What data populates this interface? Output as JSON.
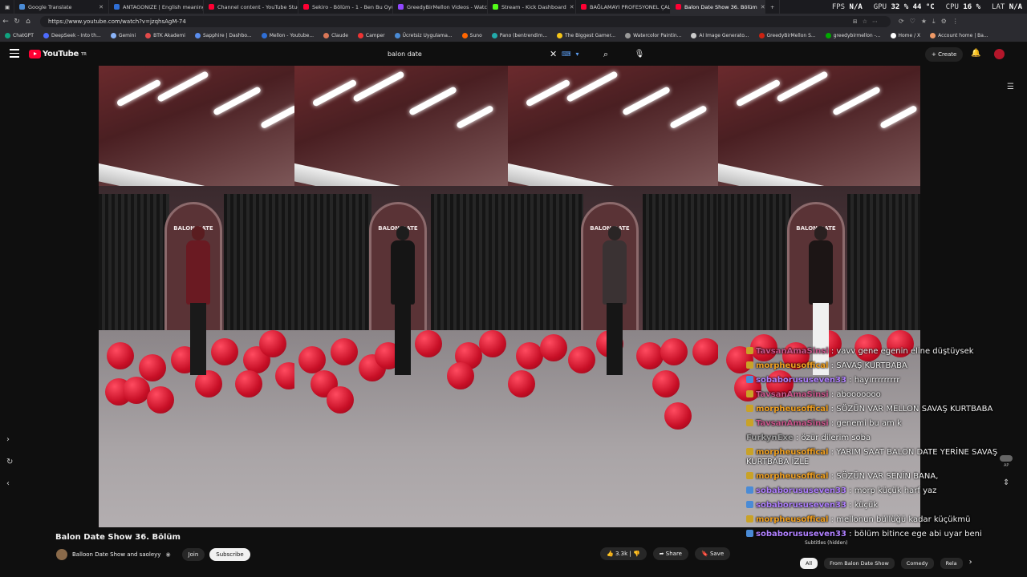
{
  "browser": {
    "tabs": [
      {
        "title": "Google Translate",
        "color": "#4a8bd6"
      },
      {
        "title": "ANTAGONIZE | English meaning -",
        "color": "#2f6fd6"
      },
      {
        "title": "Channel content - YouTube Studio",
        "color": "#ff0033"
      },
      {
        "title": "Sekiro - Bölüm - 1 - Ben Bu Oyunu",
        "color": "#ff0033"
      },
      {
        "title": "GreedyBirMellon Videos - Watch",
        "color": "#9147ff"
      },
      {
        "title": "Stream - Kick Dashboard",
        "color": "#53fc18"
      },
      {
        "title": "BAĞLAMAYI PROFESYONEL ÇALM",
        "color": "#ff0033"
      },
      {
        "title": "Balon Date Show 36. Bölüm",
        "color": "#ff0033"
      }
    ],
    "stats": {
      "fps_label": "FPS",
      "fps": "N/A",
      "gpu_label": "GPU",
      "gpu": "32 % 44 °C",
      "cpu_label": "CPU",
      "cpu": "16 %",
      "lat_label": "LAT",
      "lat": "N/A"
    },
    "url": "https://www.youtube.com/watch?v=jzqhsAgM-74",
    "bookmarks": [
      "ChatGPT",
      "DeepSeek - Into th...",
      "Gemini",
      "BTK Akademi",
      "Sapphire | Dashbo...",
      "Mellon - Youtube...",
      "Claude",
      "Camper",
      "Ücretsiz Uygulama...",
      "Suno",
      "Pano (bentrendim...",
      "The Biggest Gamer...",
      "Watercolor Paintin...",
      "AI Image Generato...",
      "GreedyBirMellon S...",
      "greedybirmellon -...",
      "Home / X",
      "Account home | Ba..."
    ]
  },
  "youtube": {
    "logo": "YouTube",
    "region": "TR",
    "search_value": "balon date",
    "create_label": "Create"
  },
  "player": {
    "panels": [
      {
        "sign": "BALON DATE",
        "top_color": "#5a1d20",
        "body_color": "#6a1a22",
        "legs_color": "#1a1a1a"
      },
      {
        "sign": "BALON DATE",
        "top_color": "#1d1d1d",
        "body_color": "#151515",
        "legs_color": "#151515"
      },
      {
        "sign": "BALON DATE",
        "top_color": "#2a2525",
        "body_color": "#3a3233",
        "legs_color": "#161616"
      },
      {
        "sign": "BALON DATE",
        "top_color": "#2a2020",
        "body_color": "#1c1515",
        "legs_color": "#f0f0f0"
      }
    ]
  },
  "chat": [
    {
      "user": "TavsanAmaSinsi",
      "color": "#c8558a",
      "badge": "gold",
      "text": "vavv gene egenin eline düştüysek"
    },
    {
      "user": "morpheusoffical",
      "color": "#f0a020",
      "badge": "gold",
      "text": "SAVAŞ KURTBABA"
    },
    {
      "user": "sobaborususeven33",
      "color": "#b080ff",
      "badge": "blue",
      "text": "hayırrrrrrrrr"
    },
    {
      "user": "TavsanAmaSinsi",
      "color": "#c8558a",
      "badge": "gold",
      "text": "abooooooo"
    },
    {
      "user": "morpheusoffical",
      "color": "#f0a020",
      "badge": "gold",
      "text": "SÖZÜN VAR MELLON SAVAŞ KURTBABA"
    },
    {
      "user": "TavsanAmaSinsi",
      "color": "#c8558a",
      "badge": "gold",
      "text": "genemi bu am k"
    },
    {
      "user": "FurkynExe",
      "color": "#a0a0a0",
      "badge": "",
      "text": "özür dilerim soba"
    },
    {
      "user": "morpheusoffical",
      "color": "#f0a020",
      "badge": "gold",
      "text": "YARIM SAAT BALON DATE YERİNE SAVAŞ KURTBABA İZLE"
    },
    {
      "user": "morpheusoffical",
      "color": "#f0a020",
      "badge": "gold",
      "text": "SÖZÜN VAR SENİN BANA,"
    },
    {
      "user": "sobaborususeven33",
      "color": "#b080ff",
      "badge": "blue",
      "text": "morp küçük harf yaz"
    },
    {
      "user": "sobaborususeven33",
      "color": "#b080ff",
      "badge": "blue",
      "text": "küçük"
    },
    {
      "user": "morpheusoffical",
      "color": "#f0a020",
      "badge": "gold",
      "text": "mellonun büllüğü kadar küçükmü"
    },
    {
      "user": "sobaborususeven33",
      "color": "#b080ff",
      "badge": "blue",
      "text": "bölüm bitince ege abi uyar beni"
    }
  ],
  "video": {
    "title": "Balon Date Show 36. Bölüm",
    "channel": "Balloon Date Show and saoleyy",
    "join_label": "Join",
    "subscribe_label": "Subscribe",
    "likes": "3.3k",
    "share_label": "Share",
    "save_label": "Save",
    "subtitles_status": "Subtitles (hidden)",
    "ap_label": "AP"
  },
  "chips": [
    "All",
    "From Balon Date Show",
    "Comedy",
    "Rela"
  ]
}
